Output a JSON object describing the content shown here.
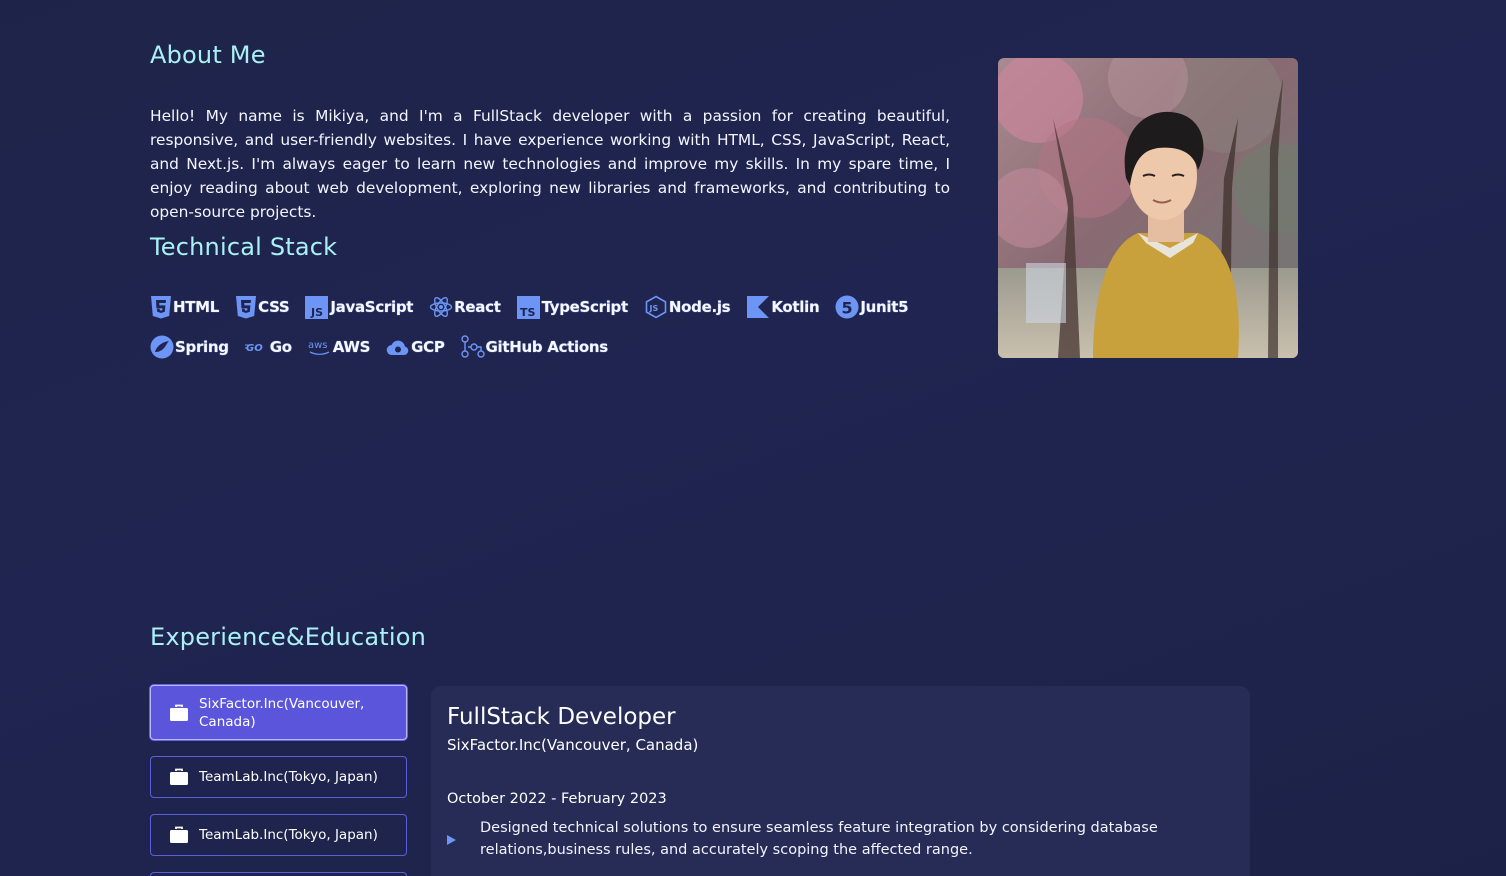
{
  "about": {
    "title": "About Me",
    "text": "Hello! My name is Mikiya, and I'm a FullStack developer with a passion for creating beautiful, responsive, and user-friendly websites. I have experience working with HTML, CSS, JavaScript, React, and Next.js. I'm always eager to learn new technologies and improve my skills. In my spare time, I enjoy reading about web development, exploring new libraries and frameworks, and contributing to open-source projects."
  },
  "stack": {
    "title": "Technical Stack",
    "items": [
      {
        "label": "HTML",
        "icon": "html5-icon"
      },
      {
        "label": "CSS",
        "icon": "css3-icon"
      },
      {
        "label": "JavaScript",
        "icon": "javascript-icon"
      },
      {
        "label": "React",
        "icon": "react-icon"
      },
      {
        "label": "TypeScript",
        "icon": "typescript-icon"
      },
      {
        "label": "Node.js",
        "icon": "nodejs-icon"
      },
      {
        "label": "Kotlin",
        "icon": "kotlin-icon"
      },
      {
        "label": "Junit5",
        "icon": "junit5-icon"
      },
      {
        "label": "Spring",
        "icon": "spring-icon"
      },
      {
        "label": "Go",
        "icon": "go-icon"
      },
      {
        "label": "AWS",
        "icon": "aws-icon"
      },
      {
        "label": "GCP",
        "icon": "gcp-icon"
      },
      {
        "label": "GitHub Actions",
        "icon": "github-actions-icon"
      }
    ]
  },
  "experience": {
    "title": "Experience&Education",
    "tabs": [
      {
        "label": "SixFactor.Inc(Vancouver, Canada)",
        "active": true
      },
      {
        "label": "TeamLab.Inc(Tokyo, Japan)",
        "active": false
      },
      {
        "label": "TeamLab.Inc(Tokyo, Japan)",
        "active": false
      },
      {
        "label": "",
        "active": false
      }
    ],
    "detail": {
      "role": "FullStack Developer",
      "company": "SixFactor.Inc(Vancouver, Canada)",
      "dates": "October 2022 - February 2023",
      "bullets": [
        "Designed technical solutions to ensure seamless feature integration by considering database relations,business rules, and accurately scoping the affected range."
      ]
    }
  },
  "colors": {
    "background": "#1f2550",
    "heading": "#a9f1f4",
    "accent": "#5b55dc",
    "icon": "#6c95f5",
    "card": "#262c55"
  }
}
